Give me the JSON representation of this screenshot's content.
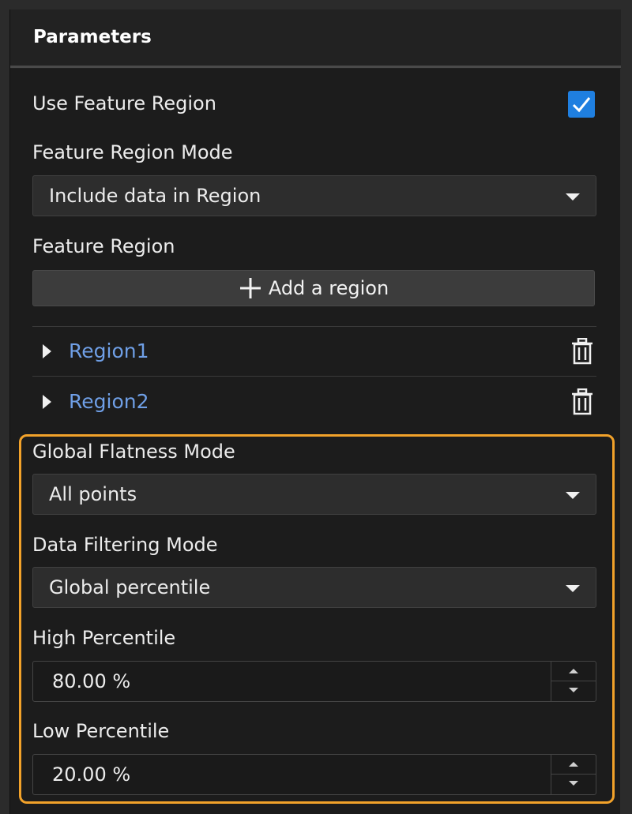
{
  "panel": {
    "title": "Parameters"
  },
  "feature_region": {
    "use_label": "Use Feature Region",
    "use_checked": true,
    "mode_label": "Feature Region Mode",
    "mode_value": "Include data in Region",
    "region_label": "Feature Region",
    "add_button_label": "Add a region",
    "regions": [
      {
        "name": "Region1"
      },
      {
        "name": "Region2"
      }
    ]
  },
  "flatness": {
    "global_mode_label": "Global Flatness Mode",
    "global_mode_value": "All points",
    "filter_mode_label": "Data Filtering Mode",
    "filter_mode_value": "Global percentile",
    "high_label": "High Percentile",
    "high_value": "80.00 %",
    "low_label": "Low Percentile",
    "low_value": "20.00 %"
  },
  "colors": {
    "accent_blue": "#1f7fe0",
    "link_blue": "#6f9fe6",
    "highlight_orange": "#f2a22a"
  },
  "icons": {
    "checkbox": "check-icon",
    "dropdown": "caret-down-icon",
    "add": "plus-icon",
    "expand": "triangle-right-icon",
    "delete": "trash-icon",
    "spin_up": "chevron-up-icon",
    "spin_down": "chevron-down-icon"
  }
}
